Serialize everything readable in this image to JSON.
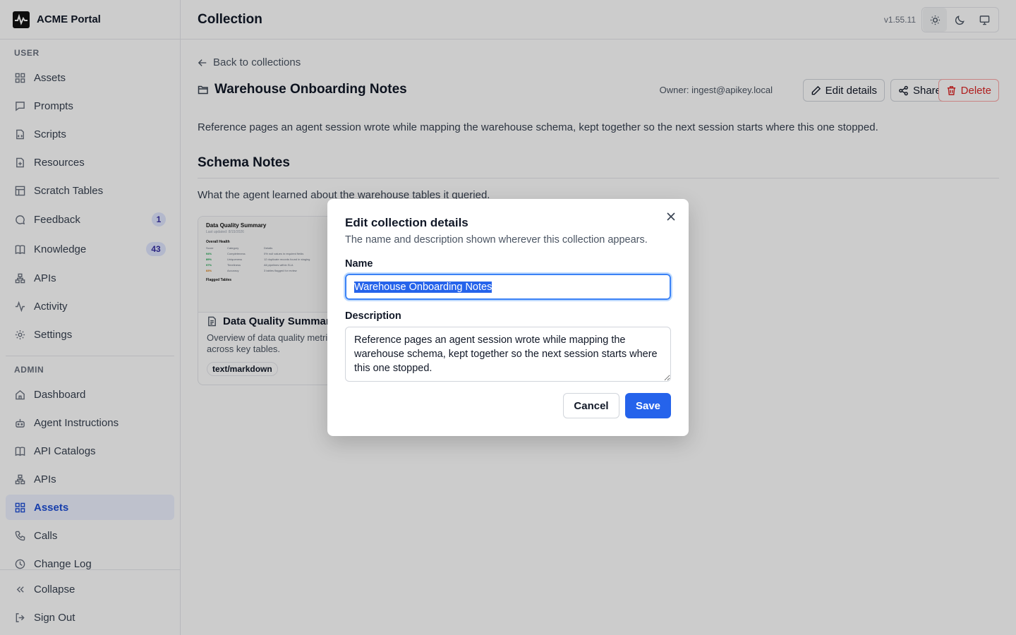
{
  "app": {
    "name": "ACME Portal",
    "version": "v1.55.11"
  },
  "header": {
    "title": "Collection"
  },
  "sidebar": {
    "user_label": "USER",
    "user_items": [
      {
        "label": "Assets",
        "icon": "grid-icon"
      },
      {
        "label": "Prompts",
        "icon": "message-icon"
      },
      {
        "label": "Scripts",
        "icon": "code-icon"
      },
      {
        "label": "Resources",
        "icon": "file-icon"
      },
      {
        "label": "Scratch Tables",
        "icon": "table-icon"
      },
      {
        "label": "Feedback",
        "icon": "chat-icon",
        "badge": "1"
      },
      {
        "label": "Knowledge",
        "icon": "book-icon",
        "badge": "43"
      },
      {
        "label": "APIs",
        "icon": "network-icon"
      },
      {
        "label": "Activity",
        "icon": "activity-icon"
      },
      {
        "label": "Settings",
        "icon": "gear-icon"
      }
    ],
    "admin_label": "ADMIN",
    "admin_items": [
      {
        "label": "Dashboard",
        "icon": "home-icon"
      },
      {
        "label": "Agent Instructions",
        "icon": "bot-icon"
      },
      {
        "label": "API Catalogs",
        "icon": "book-icon"
      },
      {
        "label": "APIs",
        "icon": "network-icon"
      },
      {
        "label": "Assets",
        "icon": "grid-icon",
        "active": true
      },
      {
        "label": "Calls",
        "icon": "phone-icon"
      },
      {
        "label": "Change Log",
        "icon": "clock-icon"
      }
    ],
    "footer": {
      "collapse": "Collapse",
      "sign_out": "Sign Out"
    }
  },
  "main": {
    "back": "Back to collections",
    "title": "Warehouse Onboarding Notes",
    "owner": "Owner: ingest@apikey.local",
    "edit_label": "Edit details",
    "share_label": "Share",
    "delete_label": "Delete",
    "description": "Reference pages an agent session wrote while mapping the warehouse schema, kept together so the next session starts where this one stopped.",
    "section_title": "Schema Notes",
    "section_sub": "What the agent learned about the warehouse tables it queried.",
    "card": {
      "name": "Data Quality Summary",
      "desc": "Overview of data quality metrics across key tables.",
      "tag": "text/markdown",
      "thumb_title": "Data Quality Summary",
      "thumb_sub": "Last updated: 8/15/2026",
      "thumb_heading": "Overall Health",
      "thumb_heading2": "Flagged Tables",
      "thumb_head": [
        "Score",
        "Category",
        "Details"
      ],
      "thumb_rows": [
        [
          "94%",
          "Completeness",
          "0% null values in required fields"
        ],
        [
          "89%",
          "Uniqueness",
          "12 duplicate records found in staging"
        ],
        [
          "97%",
          "Timeliness",
          "All pipelines within SLA"
        ],
        [
          "83%",
          "Accuracy",
          "3 tables flagged for review"
        ]
      ]
    }
  },
  "modal": {
    "title": "Edit collection details",
    "subtitle": "The name and description shown wherever this collection appears.",
    "name_label": "Name",
    "name_value": "Warehouse Onboarding Notes",
    "description_label": "Description",
    "description_value": "Reference pages an agent session wrote while mapping the warehouse schema, kept together so the next session starts where this one stopped.",
    "cancel": "Cancel",
    "save": "Save"
  }
}
